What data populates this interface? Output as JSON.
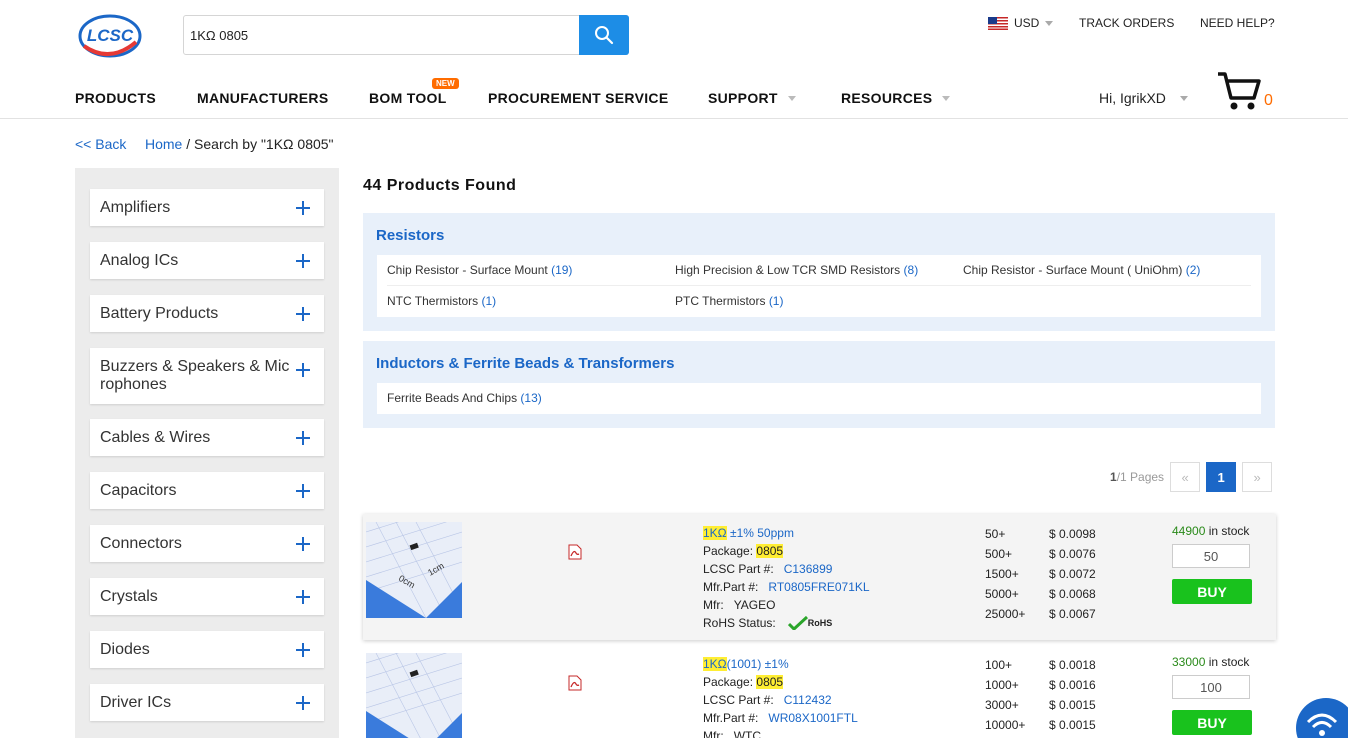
{
  "header": {
    "search_value": "1KΩ 0805",
    "currency": "USD",
    "track_orders": "TRACK ORDERS",
    "need_help": "NEED HELP?",
    "nav": [
      "PRODUCTS",
      "MANUFACTURERS",
      "BOM TOOL",
      "PROCUREMENT SERVICE",
      "SUPPORT",
      "RESOURCES"
    ],
    "new_badge": "NEW",
    "user": "Hi, IgrikXD",
    "cart_count": "0",
    "logo_text": "LCSC"
  },
  "breadcrumb": {
    "back": "<< Back",
    "home": "Home",
    "current": " / Search by \"1KΩ 0805\""
  },
  "sidebar": {
    "categories": [
      "Amplifiers",
      "Analog ICs",
      "Battery Products",
      "Buzzers & Speakers & Microphones",
      "Cables & Wires",
      "Capacitors",
      "Connectors",
      "Crystals",
      "Diodes",
      "Driver ICs"
    ]
  },
  "results": {
    "count_text": "44 Products Found",
    "groups": [
      {
        "title": "Resistors",
        "items": [
          {
            "name": "Chip Resistor - Surface Mount",
            "count": "(19)"
          },
          {
            "name": "High Precision & Low TCR SMD Resistors",
            "count": "(8)"
          },
          {
            "name": "Chip Resistor - Surface Mount ( UniOhm)",
            "count": "(2)"
          },
          {
            "name": "NTC Thermistors",
            "count": "(1)"
          },
          {
            "name": "PTC Thermistors",
            "count": "(1)"
          }
        ]
      },
      {
        "title": "Inductors & Ferrite Beads & Transformers",
        "items": [
          {
            "name": "Ferrite Beads And Chips",
            "count": "(13)"
          }
        ]
      }
    ],
    "pager": {
      "current": "1",
      "total": "/1 Pages",
      "prev": "«",
      "next": "»"
    }
  },
  "products": [
    {
      "title_hl": "1KΩ",
      "title_rest": " ±1% 50ppm",
      "package_label": "Package:",
      "package": "0805",
      "lcsc_label": "LCSC Part #:",
      "lcsc": "C136899",
      "mfr_part_label": "Mfr.Part #:",
      "mfr_part": "RT0805FRE071KL",
      "mfr_label": "Mfr:",
      "mfr": "YAGEO",
      "rohs_label": "RoHS Status:",
      "rohs_badge": "RoHS",
      "tiers": [
        [
          "50+",
          "$ 0.0098"
        ],
        [
          "500+",
          "$ 0.0076"
        ],
        [
          "1500+",
          "$ 0.0072"
        ],
        [
          "5000+",
          "$ 0.0068"
        ],
        [
          "25000+",
          "$ 0.0067"
        ]
      ],
      "stock_num": "44900",
      "stock_label": " in stock",
      "qty": "50",
      "buy": "BUY"
    },
    {
      "title_hl": "1KΩ",
      "title_rest": "(1001) ±1%",
      "package_label": "Package:",
      "package": "0805",
      "lcsc_label": "LCSC Part #:",
      "lcsc": "C112432",
      "mfr_part_label": "Mfr.Part #:",
      "mfr_part": "WR08X1001FTL",
      "mfr_label": "Mfr:",
      "mfr": "WTC",
      "tiers": [
        [
          "100+",
          "$ 0.0018"
        ],
        [
          "1000+",
          "$ 0.0016"
        ],
        [
          "3000+",
          "$ 0.0015"
        ],
        [
          "10000+",
          "$ 0.0015"
        ]
      ],
      "stock_num": "33000",
      "stock_label": " in stock",
      "qty": "100",
      "buy": "BUY"
    }
  ],
  "colors": {
    "brand_blue": "#1b67c7",
    "buy_green": "#19c21d",
    "accent_orange": "#ff6c00",
    "highlight": "#ffee33"
  }
}
